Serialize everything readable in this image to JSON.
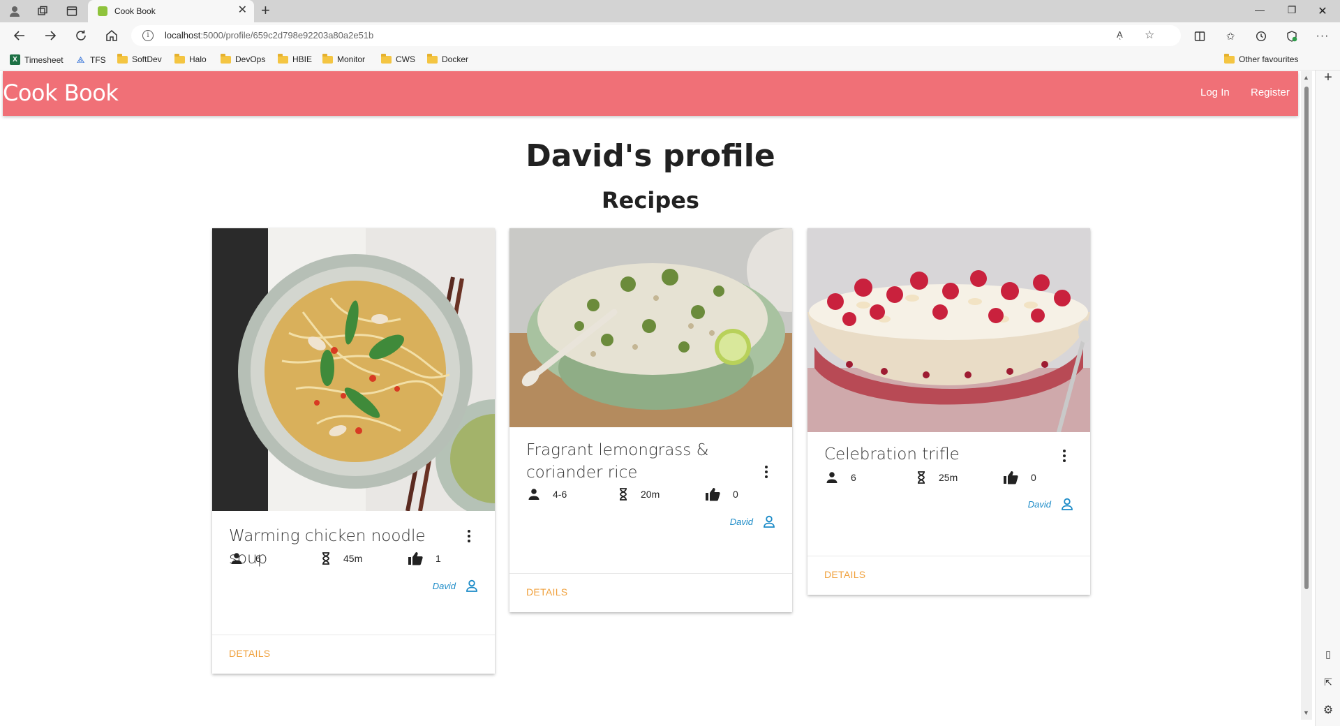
{
  "browser": {
    "tab_title": "Cook Book",
    "url_host": "localhost",
    "url_rest": ":5000/profile/659c2d798e92203a80a2e51b",
    "read_aloud_label": "Aͅ",
    "bookmarks": [
      "Timesheet",
      "TFS",
      "SoftDev",
      "Halo",
      "DevOps",
      "HBIE",
      "Monitor",
      "CWS",
      "Docker"
    ],
    "other_favourites": "Other favourites"
  },
  "app": {
    "brand": "Cook Book",
    "login_label": "Log In",
    "register_label": "Register"
  },
  "profile": {
    "title": "David's profile",
    "section_title": "Recipes"
  },
  "recipes": [
    {
      "title": "Warming chicken noodle soup",
      "servings": "6",
      "time": "45m",
      "likes": "1",
      "author": "David",
      "details_label": "DETAILS",
      "image": "noodle-soup"
    },
    {
      "title": "Fragrant lemongrass & coriander rice",
      "servings": "4-6",
      "time": "20m",
      "likes": "0",
      "author": "David",
      "details_label": "DETAILS",
      "image": "coriander-rice"
    },
    {
      "title": "Celebration trifle",
      "servings": "6",
      "time": "25m",
      "likes": "0",
      "author": "David",
      "details_label": "DETAILS",
      "image": "trifle"
    }
  ],
  "colors": {
    "header": "#f07077",
    "details": "#f0a13d",
    "author": "#1a8ac7"
  }
}
